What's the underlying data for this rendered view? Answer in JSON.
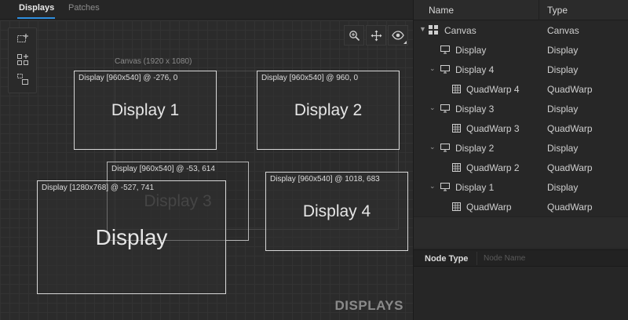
{
  "tabs": [
    {
      "label": "Displays",
      "active": true
    },
    {
      "label": "Patches",
      "active": false
    }
  ],
  "canvas": {
    "label": "Canvas (1920 x 1080)",
    "watermark": "DISPLAYS"
  },
  "toolbar_left": [
    "add-display-icon",
    "add-grid-icon",
    "add-nested-icon"
  ],
  "toolbar_right": [
    "zoom-icon",
    "move-icon",
    "visibility-icon"
  ],
  "displays": [
    {
      "id": "d1",
      "label": "Display [960x540] @ -276, 0",
      "name": "Display 1"
    },
    {
      "id": "d2",
      "label": "Display [960x540] @ 960, 0",
      "name": "Display 2"
    },
    {
      "id": "d3",
      "label": "Display [960x540] @ -53, 614",
      "name": "Display 3"
    },
    {
      "id": "d0",
      "label": "Display [1280x768] @ -527, 741",
      "name": "Display"
    },
    {
      "id": "d4",
      "label": "Display [960x540] @ 1018, 683",
      "name": "Display 4"
    }
  ],
  "tree": {
    "columns": {
      "name": "Name",
      "type": "Type"
    },
    "rows": [
      {
        "name": "Canvas",
        "type": "Canvas",
        "icon": "canvas-grid-icon",
        "expanded": true
      },
      {
        "name": "Display",
        "type": "Display",
        "icon": "monitor-icon",
        "expanded": false
      },
      {
        "name": "Display 4",
        "type": "Display",
        "icon": "monitor-icon",
        "expanded": true
      },
      {
        "name": "QuadWarp 4",
        "type": "QuadWarp",
        "icon": "quadwarp-grid-icon",
        "expanded": false
      },
      {
        "name": "Display 3",
        "type": "Display",
        "icon": "monitor-icon",
        "expanded": true
      },
      {
        "name": "QuadWarp 3",
        "type": "QuadWarp",
        "icon": "quadwarp-grid-icon",
        "expanded": false
      },
      {
        "name": "Display 2",
        "type": "Display",
        "icon": "monitor-icon",
        "expanded": true
      },
      {
        "name": "QuadWarp 2",
        "type": "QuadWarp",
        "icon": "quadwarp-grid-icon",
        "expanded": false
      },
      {
        "name": "Display 1",
        "type": "Display",
        "icon": "monitor-icon",
        "expanded": true
      },
      {
        "name": "QuadWarp",
        "type": "QuadWarp",
        "icon": "quadwarp-grid-icon",
        "expanded": false
      }
    ]
  },
  "properties": {
    "label": "Node Type",
    "placeholder": "Node Name"
  },
  "colors": {
    "accent": "#2f8fe0",
    "background": "#2b2b2b",
    "display_border": "#d7d7d7"
  }
}
